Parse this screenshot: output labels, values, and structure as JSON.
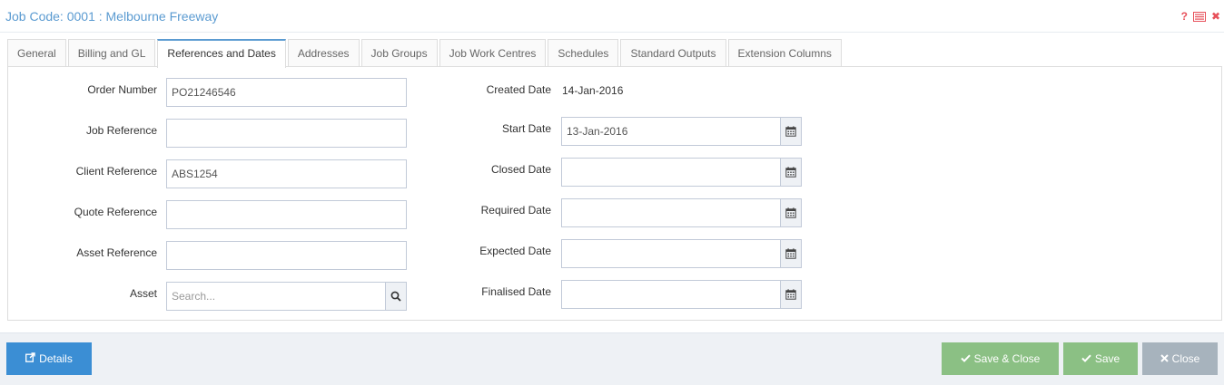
{
  "header": {
    "title": "Job Code: 0001 : Melbourne Freeway",
    "help_glyph": "?",
    "close_glyph": "✖"
  },
  "tabs": [
    {
      "label": "General"
    },
    {
      "label": "Billing and GL"
    },
    {
      "label": "References and Dates",
      "active": true
    },
    {
      "label": "Addresses"
    },
    {
      "label": "Job Groups"
    },
    {
      "label": "Job Work Centres"
    },
    {
      "label": "Schedules"
    },
    {
      "label": "Standard Outputs"
    },
    {
      "label": "Extension Columns"
    }
  ],
  "left_fields": {
    "order_number": {
      "label": "Order Number",
      "value": "PO21246546"
    },
    "job_reference": {
      "label": "Job Reference",
      "value": ""
    },
    "client_reference": {
      "label": "Client Reference",
      "value": "ABS1254"
    },
    "quote_reference": {
      "label": "Quote Reference",
      "value": ""
    },
    "asset_reference": {
      "label": "Asset Reference",
      "value": ""
    },
    "asset": {
      "label": "Asset",
      "value": "",
      "placeholder": "Search..."
    }
  },
  "right_fields": {
    "created_date": {
      "label": "Created Date",
      "value": "14-Jan-2016"
    },
    "start_date": {
      "label": "Start Date",
      "value": "13-Jan-2016"
    },
    "closed_date": {
      "label": "Closed Date",
      "value": ""
    },
    "required_date": {
      "label": "Required Date",
      "value": ""
    },
    "expected_date": {
      "label": "Expected Date",
      "value": ""
    },
    "finalised_date": {
      "label": "Finalised Date",
      "value": ""
    }
  },
  "footer": {
    "details_label": "Details",
    "save_close_label": "Save & Close",
    "save_label": "Save",
    "close_label": "Close"
  },
  "colors": {
    "accent": "#5b9bd1",
    "primary_button": "#3b8ed4",
    "success_button": "#8bc084",
    "disabled_button": "#a7b3bd",
    "danger_icon": "#e7505a"
  },
  "icons": {
    "help": "question-icon",
    "list": "list-icon",
    "close": "close-icon",
    "calendar": "calendar-icon",
    "search": "search-icon",
    "external": "external-link-icon",
    "check": "check-icon",
    "times": "times-icon"
  }
}
